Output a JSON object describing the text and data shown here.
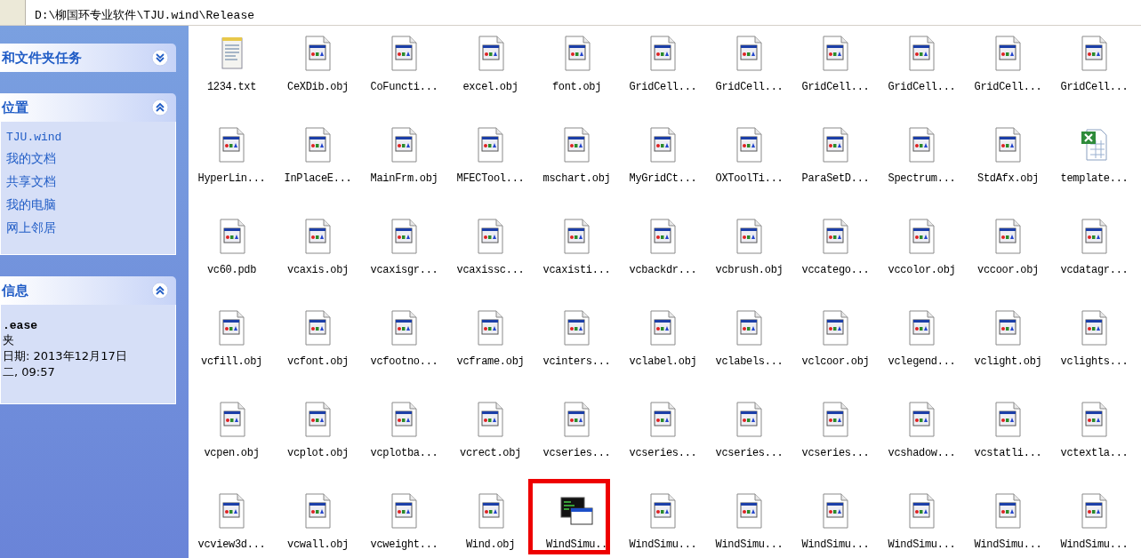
{
  "address_bar": {
    "path": "D:\\柳国环专业软件\\TJU.wind\\Release"
  },
  "sidebar": {
    "sections": [
      {
        "title": "和文件夹任务",
        "expanded": false
      },
      {
        "kind": "places",
        "title": "位置",
        "expanded": true,
        "links": [
          "TJU.wind",
          "我的文档",
          "共享文档",
          "我的电脑",
          "网上邻居"
        ]
      },
      {
        "kind": "details",
        "title": "信息",
        "expanded": true,
        "name": ".ease",
        "lines": [
          "夹",
          "日期: 2013年12月17日",
          "二, 09:57"
        ]
      }
    ]
  },
  "files": [
    {
      "name": "1234.txt",
      "kind": "txt",
      "marked": false
    },
    {
      "name": "CeXDib.obj",
      "kind": "obj",
      "marked": false
    },
    {
      "name": "CoFuncti...",
      "kind": "obj",
      "marked": false
    },
    {
      "name": "excel.obj",
      "kind": "obj",
      "marked": false
    },
    {
      "name": "font.obj",
      "kind": "obj",
      "marked": false
    },
    {
      "name": "GridCell...",
      "kind": "obj",
      "marked": false
    },
    {
      "name": "GridCell...",
      "kind": "obj",
      "marked": false
    },
    {
      "name": "GridCell...",
      "kind": "obj",
      "marked": false
    },
    {
      "name": "GridCell...",
      "kind": "obj",
      "marked": false
    },
    {
      "name": "GridCell...",
      "kind": "obj",
      "marked": false
    },
    {
      "name": "GridCell...",
      "kind": "obj",
      "marked": false
    },
    {
      "name": "HyperLin...",
      "kind": "obj",
      "marked": false
    },
    {
      "name": "InPlaceE...",
      "kind": "obj",
      "marked": false
    },
    {
      "name": "MainFrm.obj",
      "kind": "obj",
      "marked": false
    },
    {
      "name": "MFECTool...",
      "kind": "obj",
      "marked": false
    },
    {
      "name": "mschart.obj",
      "kind": "obj",
      "marked": false
    },
    {
      "name": "MyGridCt...",
      "kind": "obj",
      "marked": false
    },
    {
      "name": "OXToolTi...",
      "kind": "obj",
      "marked": false
    },
    {
      "name": "ParaSetD...",
      "kind": "obj",
      "marked": false
    },
    {
      "name": "Spectrum...",
      "kind": "obj",
      "marked": false
    },
    {
      "name": "StdAfx.obj",
      "kind": "obj",
      "marked": false
    },
    {
      "name": "template...",
      "kind": "excel",
      "marked": false
    },
    {
      "name": "vc60.pdb",
      "kind": "obj",
      "marked": false
    },
    {
      "name": "vcaxis.obj",
      "kind": "obj",
      "marked": false
    },
    {
      "name": "vcaxisgr...",
      "kind": "obj",
      "marked": false
    },
    {
      "name": "vcaxissc...",
      "kind": "obj",
      "marked": false
    },
    {
      "name": "vcaxisti...",
      "kind": "obj",
      "marked": false
    },
    {
      "name": "vcbackdr...",
      "kind": "obj",
      "marked": false
    },
    {
      "name": "vcbrush.obj",
      "kind": "obj",
      "marked": false
    },
    {
      "name": "vccatego...",
      "kind": "obj",
      "marked": false
    },
    {
      "name": "vccolor.obj",
      "kind": "obj",
      "marked": false
    },
    {
      "name": "vccoor.obj",
      "kind": "obj",
      "marked": false
    },
    {
      "name": "vcdatagr...",
      "kind": "obj",
      "marked": false
    },
    {
      "name": "vcfill.obj",
      "kind": "obj",
      "marked": false
    },
    {
      "name": "vcfont.obj",
      "kind": "obj",
      "marked": false
    },
    {
      "name": "vcfootno...",
      "kind": "obj",
      "marked": false
    },
    {
      "name": "vcframe.obj",
      "kind": "obj",
      "marked": false
    },
    {
      "name": "vcinters...",
      "kind": "obj",
      "marked": false
    },
    {
      "name": "vclabel.obj",
      "kind": "obj",
      "marked": false
    },
    {
      "name": "vclabels...",
      "kind": "obj",
      "marked": false
    },
    {
      "name": "vclcoor.obj",
      "kind": "obj",
      "marked": false
    },
    {
      "name": "vclegend...",
      "kind": "obj",
      "marked": false
    },
    {
      "name": "vclight.obj",
      "kind": "obj",
      "marked": false
    },
    {
      "name": "vclights...",
      "kind": "obj",
      "marked": false
    },
    {
      "name": "vcpen.obj",
      "kind": "obj",
      "marked": false
    },
    {
      "name": "vcplot.obj",
      "kind": "obj",
      "marked": false
    },
    {
      "name": "vcplotba...",
      "kind": "obj",
      "marked": false
    },
    {
      "name": "vcrect.obj",
      "kind": "obj",
      "marked": false
    },
    {
      "name": "vcseries...",
      "kind": "obj",
      "marked": false
    },
    {
      "name": "vcseries...",
      "kind": "obj",
      "marked": false
    },
    {
      "name": "vcseries...",
      "kind": "obj",
      "marked": false
    },
    {
      "name": "vcseries...",
      "kind": "obj",
      "marked": false
    },
    {
      "name": "vcshadow...",
      "kind": "obj",
      "marked": false
    },
    {
      "name": "vcstatli...",
      "kind": "obj",
      "marked": false
    },
    {
      "name": "vctextla...",
      "kind": "obj",
      "marked": false
    },
    {
      "name": "vcview3d...",
      "kind": "obj",
      "marked": false
    },
    {
      "name": "vcwall.obj",
      "kind": "obj",
      "marked": false
    },
    {
      "name": "vcweight...",
      "kind": "obj",
      "marked": false
    },
    {
      "name": "Wind.obj",
      "kind": "obj",
      "marked": false
    },
    {
      "name": "WindSimu..",
      "kind": "exe",
      "marked": true
    },
    {
      "name": "WindSimu...",
      "kind": "obj",
      "marked": false
    },
    {
      "name": "WindSimu...",
      "kind": "obj",
      "marked": false
    },
    {
      "name": "WindSimu...",
      "kind": "obj",
      "marked": false
    },
    {
      "name": "WindSimu...",
      "kind": "obj",
      "marked": false
    },
    {
      "name": "WindSimu...",
      "kind": "obj",
      "marked": false
    },
    {
      "name": "WindSimu...",
      "kind": "obj",
      "marked": false
    }
  ]
}
